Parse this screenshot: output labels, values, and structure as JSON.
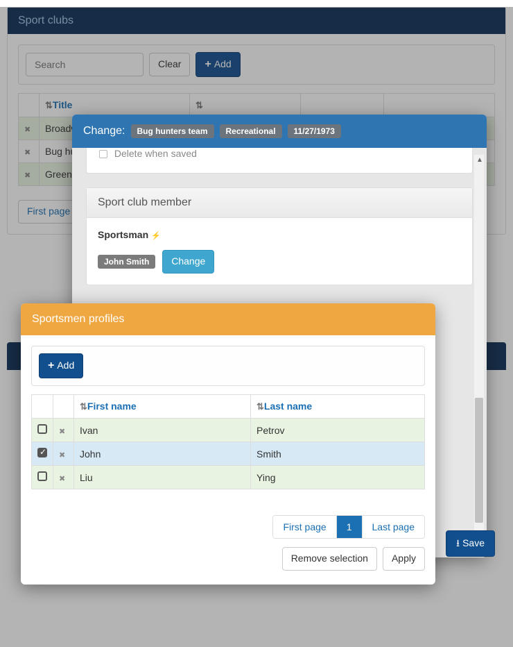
{
  "outer": {
    "title": "Sport clubs",
    "search_placeholder": "Search",
    "clear_label": "Clear",
    "add_label": "Add",
    "columns": {
      "title": "Title"
    },
    "rows": [
      {
        "title": "Broadw"
      },
      {
        "title": "Bug hu"
      },
      {
        "title": "Green Team"
      }
    ],
    "first_page": "First page"
  },
  "modal1": {
    "title": "Change:",
    "badges": [
      "Bug hunters team",
      "Recreational",
      "11/27/1973"
    ],
    "delete_when_saved": "Delete when saved",
    "section_title": "Sport club member",
    "field_label": "Sportsman",
    "current_value": "John Smith",
    "change_label": "Change",
    "save_label": "Save"
  },
  "modal2": {
    "title": "Sportsmen profiles",
    "add_label": "Add",
    "columns": {
      "first_name": "First name",
      "last_name": "Last name"
    },
    "rows": [
      {
        "first": "Ivan",
        "last": "Petrov",
        "selected": false
      },
      {
        "first": "John",
        "last": "Smith",
        "selected": true
      },
      {
        "first": "Liu",
        "last": "Ying",
        "selected": false
      }
    ],
    "first_page": "First page",
    "page_number": "1",
    "last_page": "Last page",
    "remove_selection": "Remove selection",
    "apply": "Apply"
  }
}
